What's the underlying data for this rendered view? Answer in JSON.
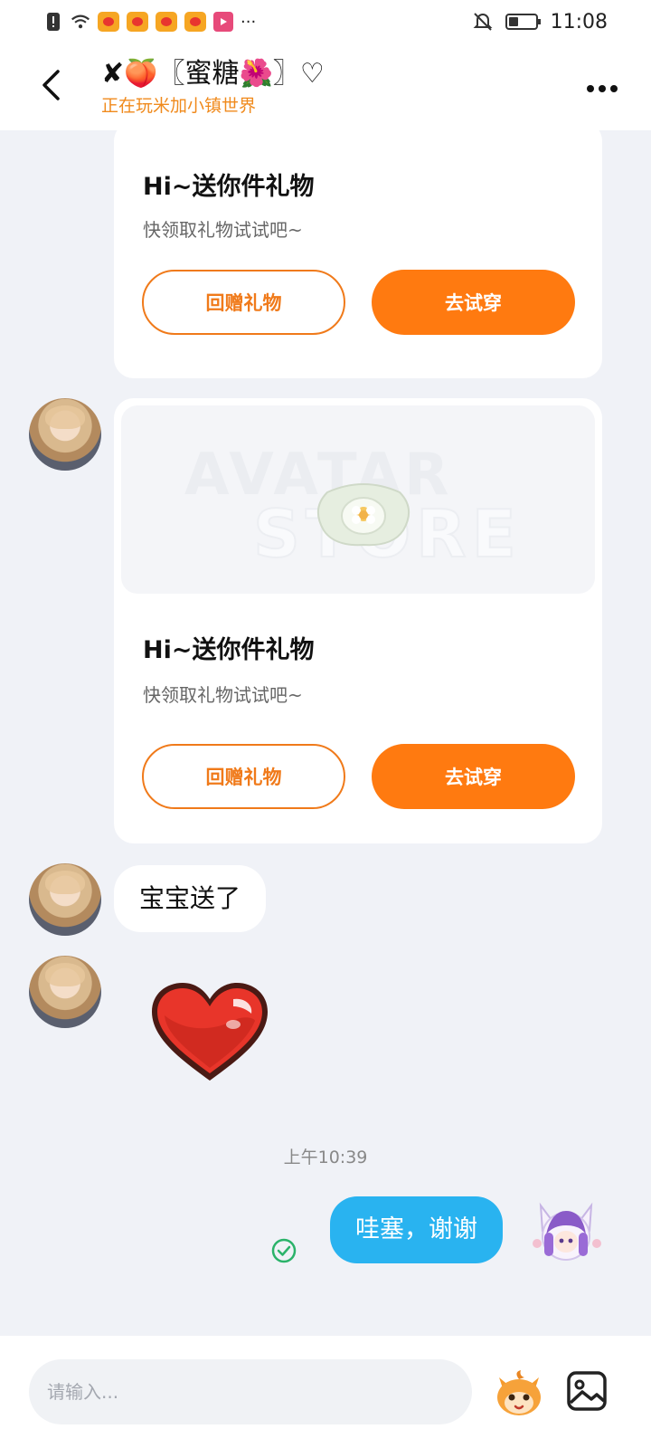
{
  "status_bar": {
    "time": "11:08",
    "more_notifications": "···",
    "icons": [
      "alert-icon",
      "wifi-icon",
      "weibo-icon",
      "weibo-icon",
      "weibo-icon",
      "weibo-icon",
      "video-app-icon",
      "bell-muted-icon",
      "battery-icon"
    ]
  },
  "header": {
    "title": "✘🍑〖蜜糖🌺〗♡",
    "subtitle": "正在玩米加小镇世界",
    "back_icon": "chevron-left-icon",
    "more_icon": "more-dots-icon"
  },
  "messages": {
    "gift_card_1": {
      "title": "Hi~送你件礼物",
      "subtitle": "快领取礼物试试吧~",
      "return_gift_label": "回赠礼物",
      "try_on_label": "去试穿"
    },
    "gift_card_2": {
      "watermark_line1": "AVATAR",
      "watermark_line2": "STORE",
      "title": "Hi~送你件礼物",
      "subtitle": "快领取礼物试试吧~",
      "return_gift_label": "回赠礼物",
      "try_on_label": "去试穿"
    },
    "text_1": "宝宝送了",
    "sticker": "heart-sticker",
    "time_separator": "上午10:39",
    "own_message": "哇塞，谢谢"
  },
  "input_bar": {
    "placeholder": "请输入...",
    "mascot_icon": "mascot-emoji-icon",
    "image_icon": "image-icon"
  },
  "colors": {
    "accent_orange": "#ff7a10",
    "subtitle_orange": "#f08a1c",
    "own_bubble_blue": "#29b3f0",
    "background": "#f0f2f7"
  }
}
